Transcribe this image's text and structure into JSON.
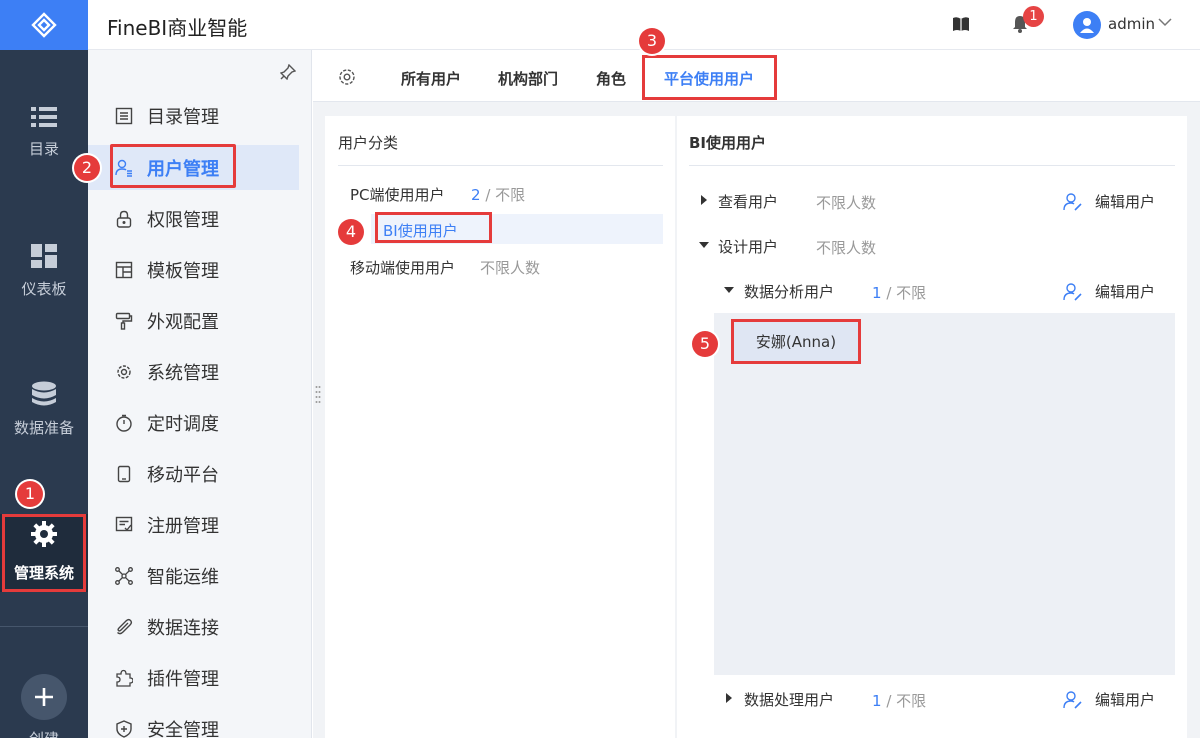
{
  "app": {
    "title": "FineBI商业智能",
    "user": "admin",
    "notification_count": "1",
    "accent": "#3d7ff5",
    "highlight": "#e53b3b"
  },
  "rail": {
    "items": [
      {
        "label": "目录",
        "icon": "list-icon"
      },
      {
        "label": "仪表板",
        "icon": "dashboard-icon"
      },
      {
        "label": "数据准备",
        "icon": "database-icon"
      },
      {
        "label": "管理系统",
        "icon": "gear-icon"
      }
    ],
    "create_label": "创建"
  },
  "menu": {
    "items": [
      {
        "label": "目录管理",
        "icon": "catalog-icon"
      },
      {
        "label": "用户管理",
        "icon": "user-manage-icon"
      },
      {
        "label": "权限管理",
        "icon": "lock-icon"
      },
      {
        "label": "模板管理",
        "icon": "template-icon"
      },
      {
        "label": "外观配置",
        "icon": "paint-roller-icon"
      },
      {
        "label": "系统管理",
        "icon": "settings-icon"
      },
      {
        "label": "定时调度",
        "icon": "timer-icon"
      },
      {
        "label": "移动平台",
        "icon": "mobile-icon"
      },
      {
        "label": "注册管理",
        "icon": "register-icon"
      },
      {
        "label": "智能运维",
        "icon": "network-icon"
      },
      {
        "label": "数据连接",
        "icon": "attachment-icon"
      },
      {
        "label": "插件管理",
        "icon": "plugin-icon"
      },
      {
        "label": "安全管理",
        "icon": "shield-icon"
      }
    ]
  },
  "tabs": [
    "所有用户",
    "机构部门",
    "角色",
    "平台使用用户"
  ],
  "left_panel": {
    "title": "用户分类",
    "categories": [
      {
        "label": "PC端使用用户",
        "count": "2",
        "limit": " / 不限"
      },
      {
        "label": "BI使用用户"
      },
      {
        "label": "移动端使用用户",
        "limit": "不限人数"
      }
    ]
  },
  "right_panel": {
    "title": "BI使用用户",
    "rows": {
      "viewer": {
        "label": "查看用户",
        "limit": "不限人数",
        "edit": "编辑用户"
      },
      "designer": {
        "label": "设计用户",
        "limit": "不限人数"
      },
      "analyst": {
        "label": "数据分析用户",
        "count": "1",
        "limit": " / 不限",
        "edit": "编辑用户"
      },
      "processor": {
        "label": "数据处理用户",
        "count": "1",
        "limit": " / 不限",
        "edit": "编辑用户"
      }
    },
    "users": [
      "安娜(Anna)"
    ]
  },
  "callouts": [
    "1",
    "2",
    "3",
    "4",
    "5"
  ]
}
